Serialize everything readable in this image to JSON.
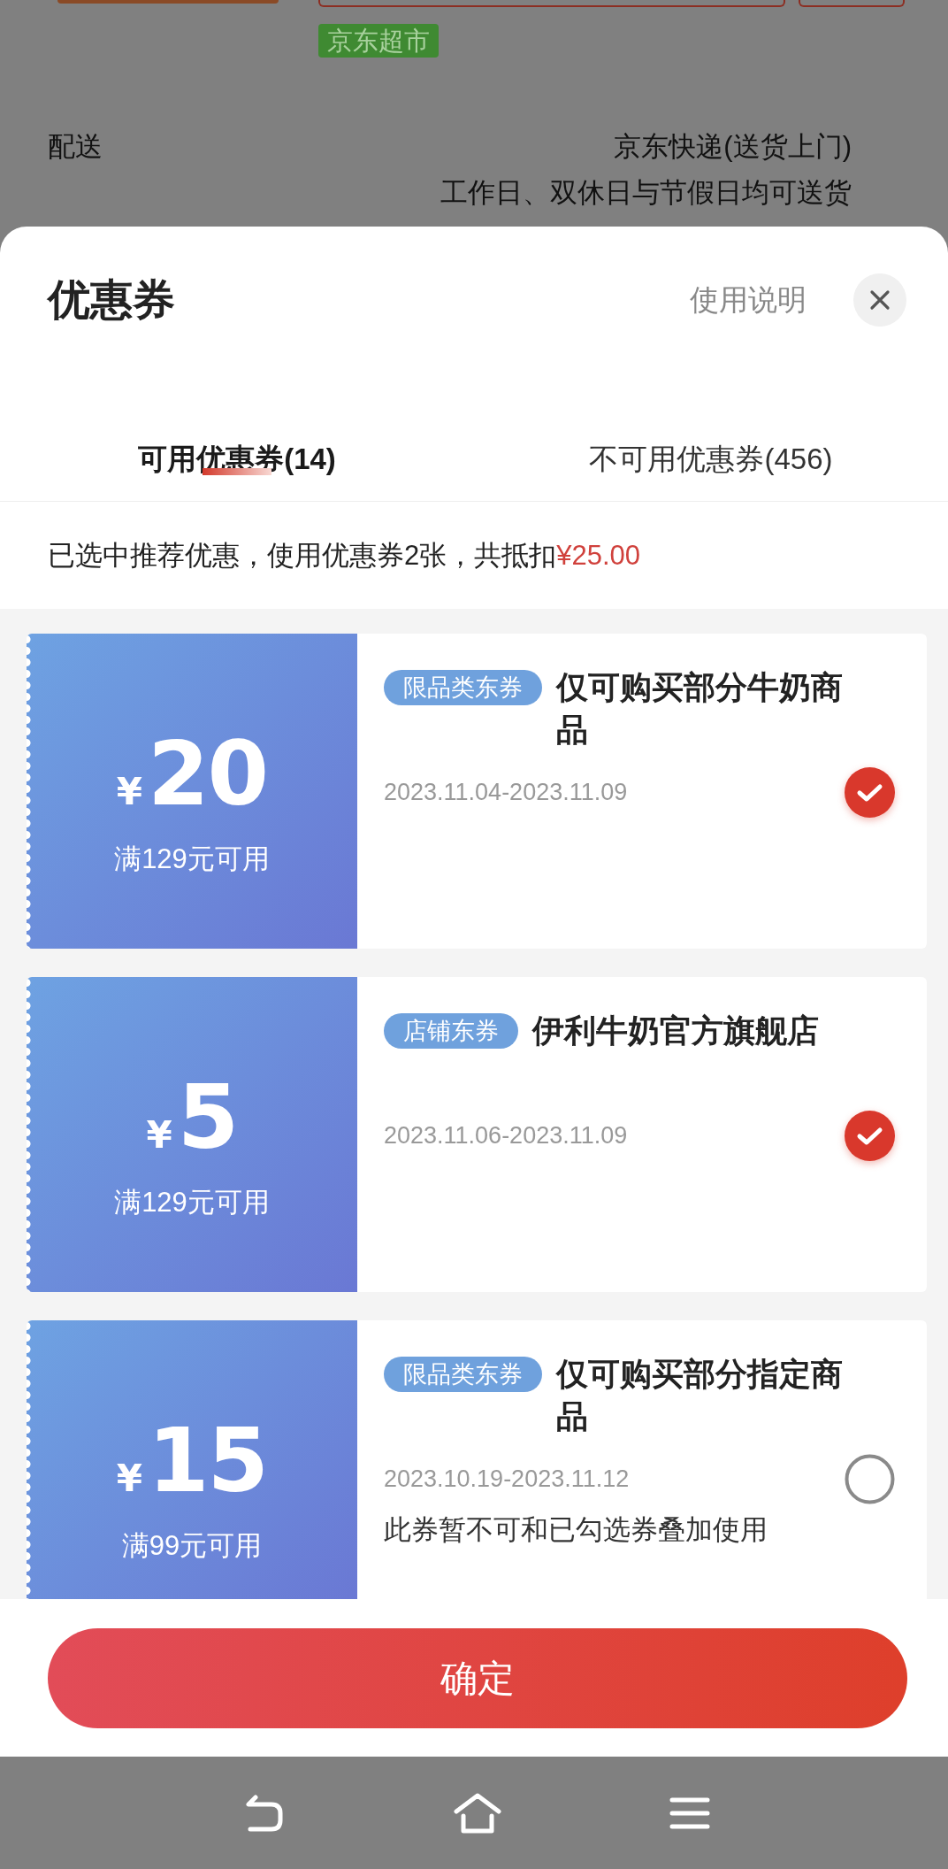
{
  "background": {
    "store_tag": "京东超市",
    "delivery": {
      "label": "配送",
      "method": "京东快递(送货上门)",
      "schedule": "工作日、双休日与节假日均可送货"
    }
  },
  "sheet": {
    "title": "优惠券",
    "help_link": "使用说明"
  },
  "tabs": [
    {
      "label": "可用优惠券(14)",
      "selected": true
    },
    {
      "label": "不可用优惠券(456)",
      "selected": false
    }
  ],
  "summary": {
    "text": "已选中推荐优惠，使用优惠券2张，共抵扣",
    "amount": "¥25.00"
  },
  "coupons": [
    {
      "currency": "¥",
      "amount": "20",
      "condition": "满129元可用",
      "tag": "限品类东券",
      "title": "仅可购买部分牛奶商品",
      "validity": "2023.11.04-2023.11.09",
      "selected": true
    },
    {
      "currency": "¥",
      "amount": "5",
      "condition": "满129元可用",
      "tag": "店铺东券",
      "title": "伊利牛奶官方旗舰店",
      "validity": "2023.11.06-2023.11.09",
      "selected": true
    },
    {
      "currency": "¥",
      "amount": "15",
      "condition": "满99元可用",
      "tag": "限品类东券",
      "title": "仅可购买部分指定商品",
      "validity": "2023.10.19-2023.11.12",
      "note": "此券暂不可和已勾选券叠加使用",
      "selected": false
    }
  ],
  "confirm_button": "确定"
}
